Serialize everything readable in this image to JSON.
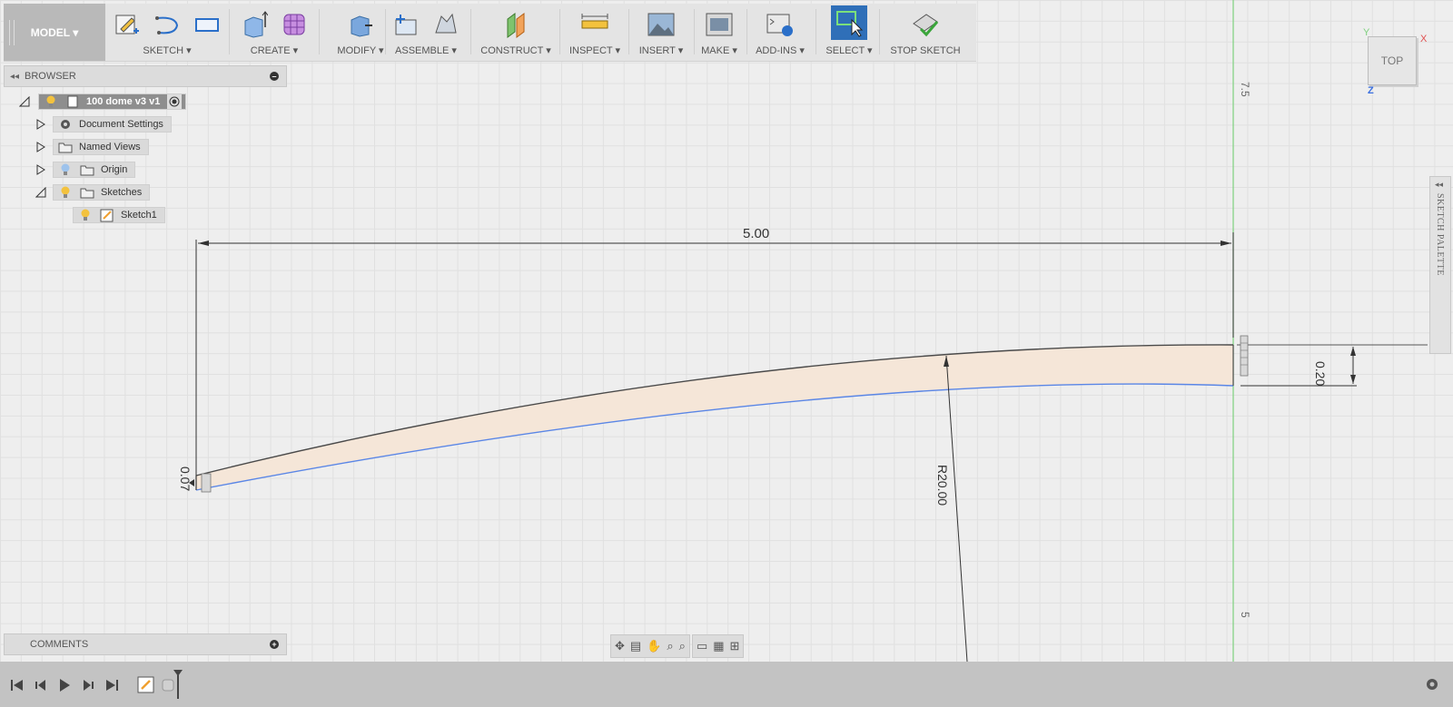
{
  "toolbar": {
    "workspace": "MODEL ▾",
    "groups": [
      {
        "label": "SKETCH ▾"
      },
      {
        "label": "CREATE ▾"
      },
      {
        "label": "MODIFY ▾"
      },
      {
        "label": "ASSEMBLE ▾"
      },
      {
        "label": "CONSTRUCT ▾"
      },
      {
        "label": "INSPECT ▾"
      },
      {
        "label": "INSERT ▾"
      },
      {
        "label": "MAKE ▾"
      },
      {
        "label": "ADD-INS ▾"
      },
      {
        "label": "SELECT ▾"
      },
      {
        "label": "STOP SKETCH"
      }
    ]
  },
  "browser": {
    "title": "BROWSER",
    "root": "100 dome v3 v1",
    "items": [
      {
        "label": "Document Settings"
      },
      {
        "label": "Named Views"
      },
      {
        "label": "Origin"
      },
      {
        "label": "Sketches"
      },
      {
        "label": "Sketch1"
      }
    ]
  },
  "comments": {
    "title": "COMMENTS"
  },
  "viewcube": {
    "face": "TOP",
    "x_label": "X",
    "y_label": "Y",
    "z_label": "Z"
  },
  "palette": {
    "label": "SKETCH PALETTE"
  },
  "dimensions": {
    "width": "5.00",
    "thickness_end": "0.20",
    "thickness_start": "0.07",
    "radius": "R20.00"
  },
  "ruler": {
    "top": "7.5",
    "bottom": "5"
  },
  "colors": {
    "outer_arc": "#4a4a4a",
    "inner_arc": "#5a86e6",
    "fill": "#f5e6d8",
    "axis_green": "#7ed07e",
    "toolbar_bg": "#e4e4e4",
    "timeline_bg": "#c3c3c3"
  }
}
